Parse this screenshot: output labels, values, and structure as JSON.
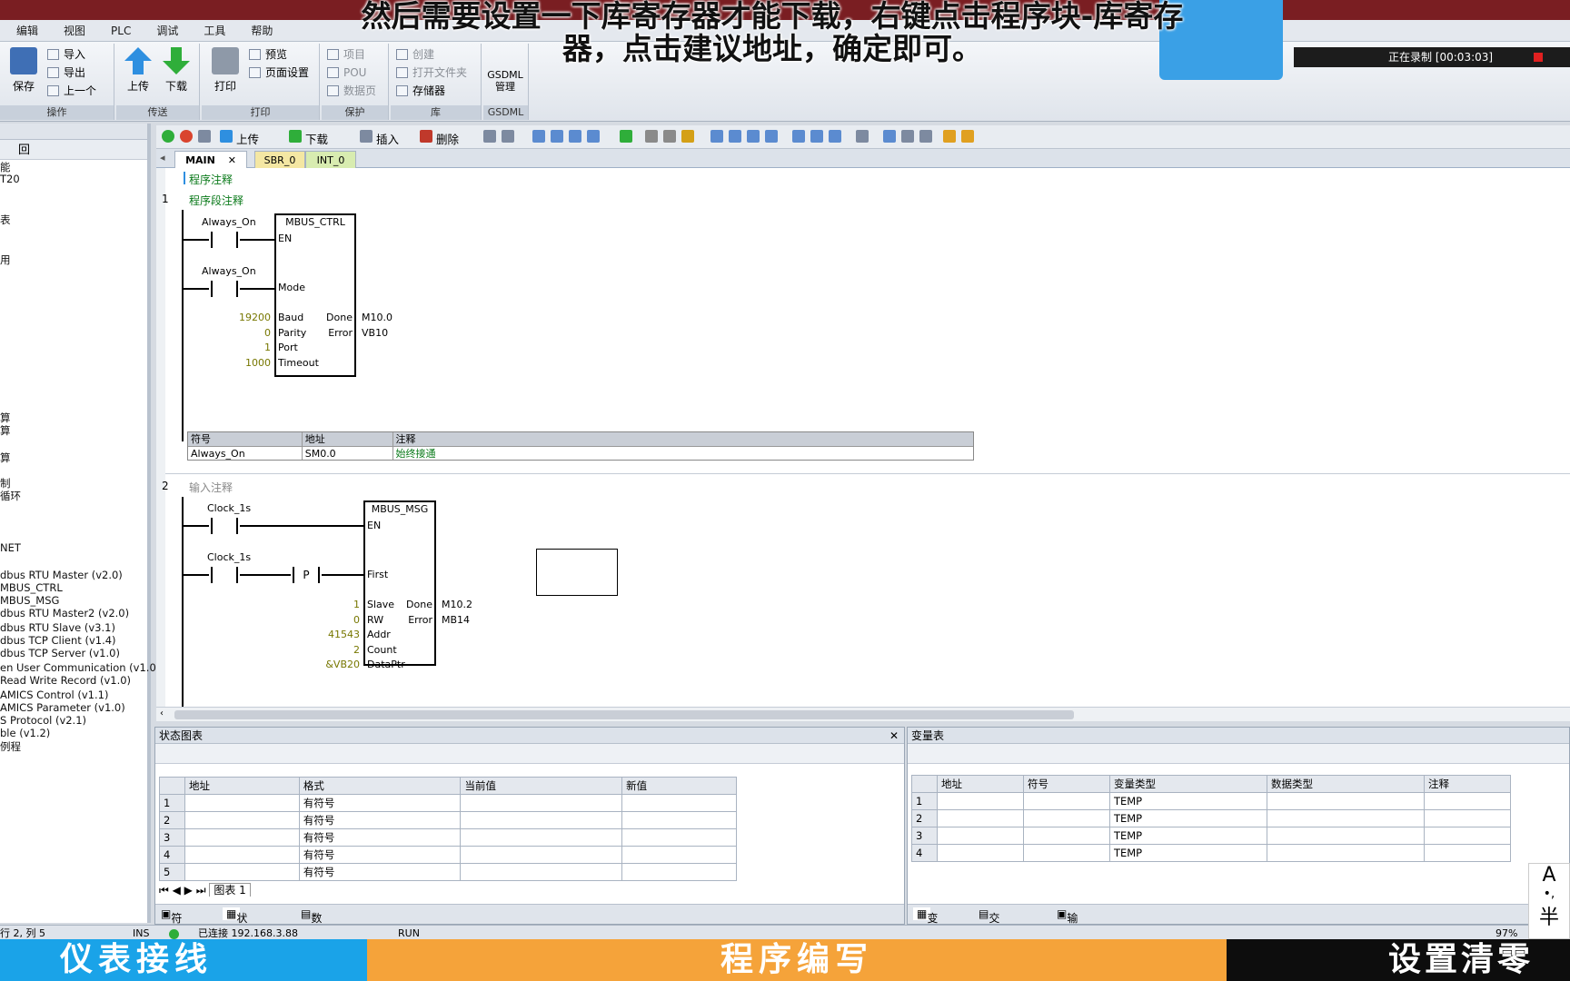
{
  "subtitle": {
    "line1": "然后需要设置一下库寄存器才能下载，右键点击程序块-库寄存",
    "line2": "器，点击建议地址，确定即可。"
  },
  "menu": [
    "编辑",
    "视图",
    "PLC",
    "调试",
    "工具",
    "帮助"
  ],
  "ribbon": {
    "save": "保存",
    "import": "导入",
    "export": "导出",
    "prev": "上一个",
    "group_op": "操作",
    "upload": "上传",
    "download": "下载",
    "group_transfer": "传送",
    "print": "打印",
    "preview": "预览",
    "page_setup": "页面设置",
    "group_print": "打印",
    "project": "项目",
    "pou": "POU",
    "datapage": "数据页",
    "group_protect": "保护",
    "create": "创建",
    "open_folder": "打开文件夹",
    "memory": "存储器",
    "group_lib": "库",
    "gsdml": "GSDML",
    "gsdml_mgr": "管理",
    "group_gsdml": "GSDML"
  },
  "recording": {
    "text": "正在录制 [00:03:03]"
  },
  "left_tree": {
    "header_icon": "tree-icon",
    "header_text": "回",
    "items": [
      "能",
      "T20",
      "表",
      "用",
      "算",
      "算",
      "算",
      "制",
      "循环",
      "NET",
      "dbus RTU Master (v2.0)",
      "MBUS_CTRL",
      "MBUS_MSG",
      "dbus RTU Master2 (v2.0)",
      "dbus RTU Slave (v3.1)",
      "dbus TCP Client (v1.4)",
      "dbus TCP Server (v1.0)",
      "en User Communication (v1.0)",
      "Read Write Record (v1.0)",
      "AMICS Control (v1.1)",
      "AMICS Parameter (v1.0)",
      "S Protocol (v2.1)",
      "ble (v1.2)",
      "例程"
    ]
  },
  "toolbar2": {
    "upload": "上传",
    "download": "下载",
    "insert": "插入",
    "delete": "删除"
  },
  "tabs": [
    "MAIN",
    "SBR_0",
    "INT_0"
  ],
  "editor": {
    "program_comment": "程序注释",
    "net1": {
      "num": "1",
      "comment": "程序段注释",
      "c1": "Always_On",
      "c2": "Always_On",
      "block": "MBUS_CTRL",
      "en": "EN",
      "mode": "Mode",
      "inputs": [
        {
          "val": "19200",
          "pin": "Baud"
        },
        {
          "val": "0",
          "pin": "Parity"
        },
        {
          "val": "1",
          "pin": "Port"
        },
        {
          "val": "1000",
          "pin": "Timeout"
        }
      ],
      "outputs": [
        {
          "pin": "Done",
          "val": "M10.0"
        },
        {
          "pin": "Error",
          "val": "VB10"
        }
      ]
    },
    "symtable": {
      "h_sym": "符号",
      "h_addr": "地址",
      "h_cmt": "注释",
      "sym": "Always_On",
      "addr": "SM0.0",
      "cmt": "始终接通"
    },
    "net2": {
      "num": "2",
      "comment": "输入注释",
      "c1": "Clock_1s",
      "c2": "Clock_1s",
      "p": "P",
      "block": "MBUS_MSG",
      "en": "EN",
      "first": "First",
      "inputs": [
        {
          "val": "1",
          "pin": "Slave"
        },
        {
          "val": "0",
          "pin": "RW"
        },
        {
          "val": "41543",
          "pin": "Addr"
        },
        {
          "val": "2",
          "pin": "Count"
        },
        {
          "val": "&VB20",
          "pin": "DataPtr"
        }
      ],
      "outputs": [
        {
          "pin": "Done",
          "val": "M10.2"
        },
        {
          "pin": "Error",
          "val": "MB14"
        }
      ]
    }
  },
  "status_panel": {
    "title": "状态图表",
    "headers": [
      "地址",
      "格式",
      "当前值",
      "新值"
    ],
    "rows": [
      [
        "1",
        "",
        "有符号",
        "",
        ""
      ],
      [
        "2",
        "",
        "有符号",
        "",
        ""
      ],
      [
        "3",
        "",
        "有符号",
        "",
        ""
      ],
      [
        "4",
        "",
        "有符号",
        "",
        ""
      ],
      [
        "5",
        "",
        "有符号",
        "",
        ""
      ]
    ],
    "sheet_tab": "图表 1",
    "bottom_tabs": [
      "符号表",
      "状态图表",
      "数据块"
    ]
  },
  "var_panel": {
    "title": "变量表",
    "headers": [
      "地址",
      "符号",
      "变量类型",
      "数据类型",
      "注释"
    ],
    "rows": [
      [
        "1",
        "",
        "",
        "TEMP",
        "",
        ""
      ],
      [
        "2",
        "",
        "",
        "TEMP",
        "",
        ""
      ],
      [
        "3",
        "",
        "",
        "TEMP",
        "",
        ""
      ],
      [
        "4",
        "",
        "",
        "TEMP",
        "",
        ""
      ]
    ],
    "bottom_tabs": [
      "变量表",
      "交叉引用",
      "输出窗口"
    ]
  },
  "statusbar": {
    "pos": "行 2, 列 5",
    "ins": "INS",
    "conn": "已连接 192.168.3.88",
    "run": "RUN",
    "zoom": "97%"
  },
  "banner": {
    "left": "仪表接线",
    "mid": "程序编写",
    "right": "设置清零"
  },
  "ime": {
    "a": "A",
    "p": "•,",
    "half": "半"
  }
}
